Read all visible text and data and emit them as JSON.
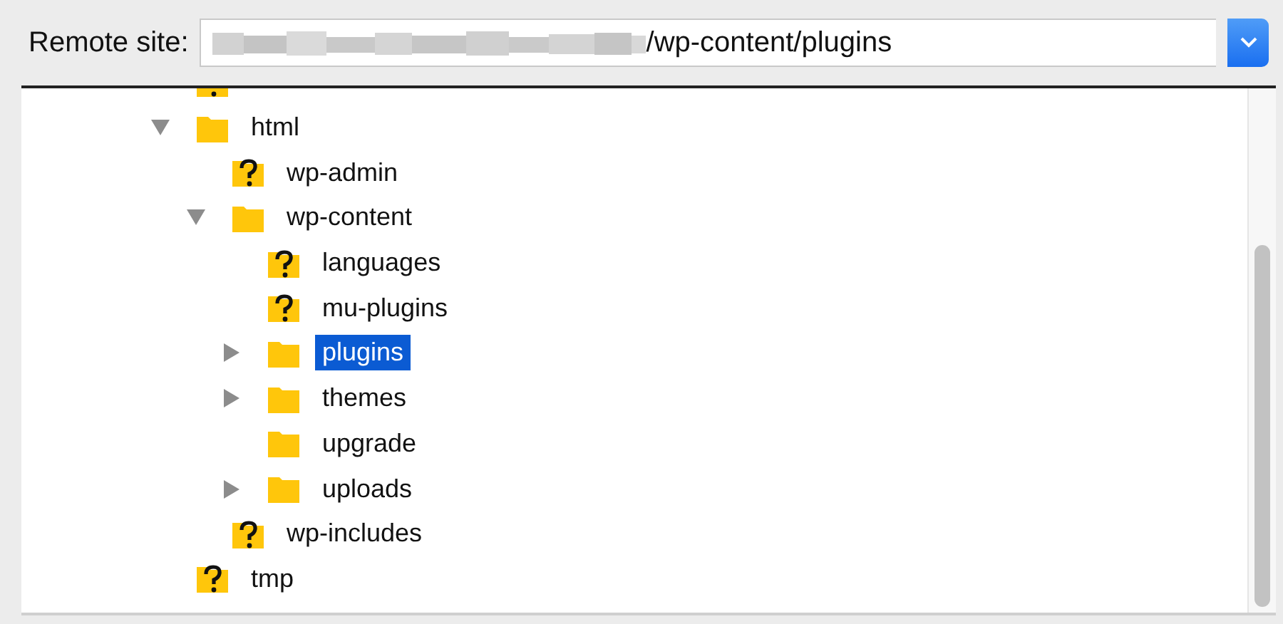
{
  "remote_site": {
    "label": "Remote site:",
    "value": "/wp-content/plugins"
  },
  "tree": {
    "items": [
      {
        "kind": "unknown",
        "selected": false
      },
      {
        "name": "html",
        "kind": "folder",
        "expanded": true,
        "selected": false,
        "children": [
          {
            "name": "wp-admin",
            "kind": "unknown",
            "selected": false
          },
          {
            "name": "wp-content",
            "kind": "folder",
            "expanded": true,
            "selected": false,
            "children": [
              {
                "name": "languages",
                "kind": "unknown",
                "selected": false
              },
              {
                "name": "mu-plugins",
                "kind": "unknown",
                "selected": false
              },
              {
                "name": "plugins",
                "kind": "folder",
                "expanded": false,
                "selected": true
              },
              {
                "name": "themes",
                "kind": "folder",
                "expanded": false,
                "selected": false
              },
              {
                "name": "upgrade",
                "kind": "folder",
                "selected": false
              },
              {
                "name": "uploads",
                "kind": "folder",
                "expanded": false,
                "selected": false
              }
            ]
          },
          {
            "name": "wp-includes",
            "kind": "unknown",
            "selected": false
          }
        ]
      },
      {
        "name": "tmp",
        "kind": "unknown",
        "selected": false
      }
    ]
  }
}
